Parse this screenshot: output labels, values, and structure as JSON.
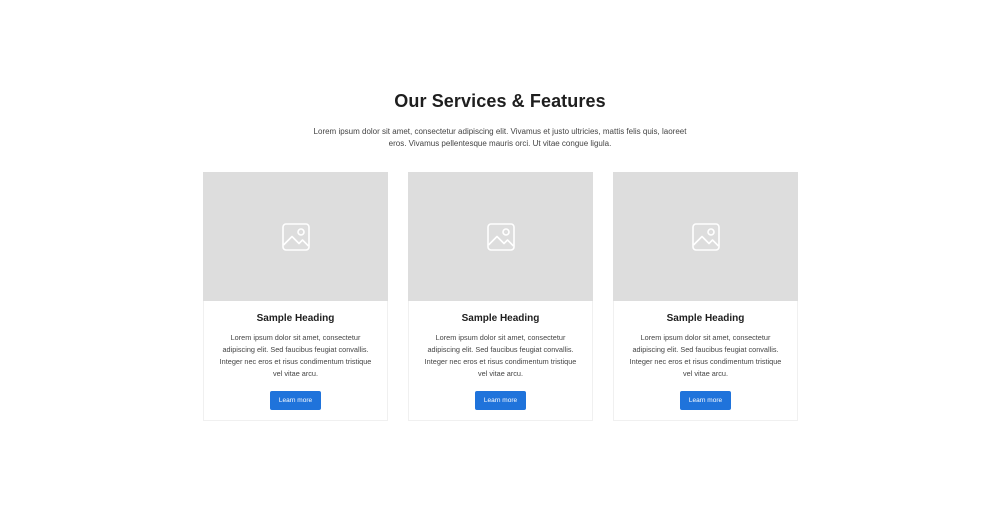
{
  "section": {
    "title": "Our Services & Features",
    "subtitle": "Lorem ipsum dolor sit amet, consectetur adipiscing elit. Vivamus et justo ultricies, mattis felis quis, laoreet eros. Vivamus pellentesque mauris orci. Ut vitae congue ligula."
  },
  "cards": [
    {
      "image_icon": "image-placeholder-icon",
      "heading": "Sample Heading",
      "text": "Lorem ipsum dolor sit amet, consectetur adipiscing elit. Sed faucibus feugiat convallis. Integer nec eros et risus condimentum tristique vel vitae arcu.",
      "button_label": "Learn more"
    },
    {
      "image_icon": "image-placeholder-icon",
      "heading": "Sample Heading",
      "text": "Lorem ipsum dolor sit amet, consectetur adipiscing elit. Sed faucibus feugiat convallis. Integer nec eros et risus condimentum tristique vel vitae arcu.",
      "button_label": "Learn more"
    },
    {
      "image_icon": "image-placeholder-icon",
      "heading": "Sample Heading",
      "text": "Lorem ipsum dolor sit amet, consectetur adipiscing elit. Sed faucibus feugiat convallis. Integer nec eros et risus condimentum tristique vel vitae arcu.",
      "button_label": "Learn more"
    }
  ],
  "colors": {
    "accent": "#1f73db",
    "image_placeholder_bg": "#dddddd",
    "heading_text": "#1e1e1e",
    "body_text": "#444444"
  }
}
